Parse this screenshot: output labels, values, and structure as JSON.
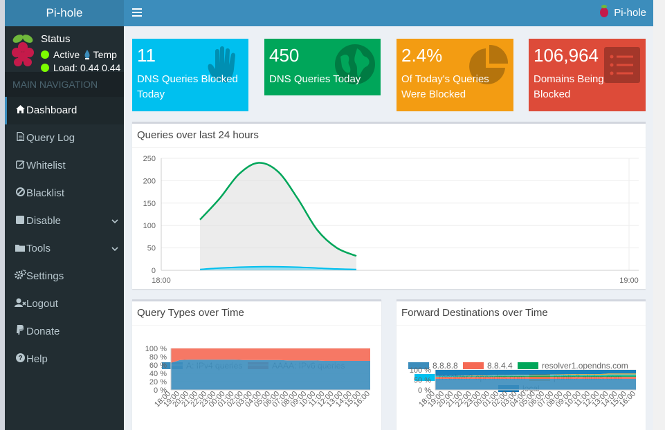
{
  "sidebar": {
    "logo": "Pi-hole",
    "status": {
      "title": "Status",
      "active": "Active",
      "temp": "Temp",
      "load_label": "Load:",
      "load_values": "0.44  0.44"
    },
    "nav_header": "MAIN NAVIGATION",
    "items": [
      {
        "label": "Dashboard",
        "icon": "home-icon"
      },
      {
        "label": "Query Log",
        "icon": "file-icon"
      },
      {
        "label": "Whitelist",
        "icon": "pencil-square-icon"
      },
      {
        "label": "Blacklist",
        "icon": "ban-icon"
      },
      {
        "label": "Disable",
        "icon": "stop-icon"
      },
      {
        "label": "Tools",
        "icon": "folder-icon"
      },
      {
        "label": "Settings",
        "icon": "gears-icon"
      },
      {
        "label": "Logout",
        "icon": "user-times-icon"
      },
      {
        "label": "Donate",
        "icon": "paypal-icon"
      },
      {
        "label": "Help",
        "icon": "question-circle-icon"
      }
    ]
  },
  "topbar": {
    "brand": "Pi-hole"
  },
  "stats": [
    {
      "value": "11",
      "label": "DNS Queries Blocked Today",
      "label_line1": "DNS Queries Blocked",
      "label_line2": "Today",
      "color": "#00c0ef",
      "icon": "hand-icon"
    },
    {
      "value": "450",
      "label": "DNS Queries Today",
      "label_line1": "DNS Queries Today",
      "label_line2": "",
      "color": "#00a65a",
      "icon": "globe-icon"
    },
    {
      "value": "2.4%",
      "label": "Of Today's Queries Were Blocked",
      "label_line1": "Of Today's Queries",
      "label_line2": "Were Blocked",
      "color": "#f39c12",
      "icon": "pie-chart-icon"
    },
    {
      "value": "106,964",
      "label": "Domains Being Blocked",
      "label_line1": "Domains Being",
      "label_line2": "Blocked",
      "color": "#dd4b39",
      "icon": "list-icon"
    }
  ],
  "chart_data": [
    {
      "type": "area",
      "title": "Queries over last 24 hours",
      "x": [
        "18:10",
        "18:15",
        "18:20",
        "18:25",
        "18:30",
        "18:35",
        "18:40",
        "18:45",
        "18:50"
      ],
      "x_tick_labels": [
        "18:00",
        "19:00"
      ],
      "ylim": [
        0,
        250
      ],
      "y_ticks": [
        0,
        50,
        100,
        150,
        200,
        250
      ],
      "series": [
        {
          "values": [
            113,
            160,
            215,
            240,
            220,
            160,
            90,
            50,
            32
          ],
          "color": "#00a65a"
        },
        {
          "values": [
            2,
            5,
            7,
            8,
            8,
            7,
            5,
            3,
            2
          ],
          "color": "#00c0ef"
        }
      ],
      "grid": true
    },
    {
      "type": "area",
      "title": "Query Types over Time",
      "x": [
        "18:00",
        "19:00",
        "20:00",
        "21:00",
        "22:00",
        "23:00",
        "00:00",
        "01:00",
        "02:00",
        "03:00",
        "04:00",
        "05:00",
        "06:00",
        "07:00",
        "08:00",
        "09:00",
        "10:00",
        "11:00",
        "12:00",
        "13:00",
        "14:00",
        "15:00",
        "16:00"
      ],
      "ylim": [
        0,
        100
      ],
      "y_ticks": [
        "0 %",
        "20 %",
        "40 %",
        "60 %",
        "80 %",
        "100 %"
      ],
      "series": [
        {
          "name": "A: IPv4 queries",
          "values": [
            65,
            72,
            73,
            73,
            73,
            73,
            73,
            73,
            72,
            72,
            72,
            72,
            72,
            71,
            71,
            71,
            71,
            70,
            70,
            70,
            70,
            70,
            70
          ],
          "color": "#3c8dbc"
        },
        {
          "name": "AAAA: IPv6 queries",
          "values": [
            35,
            28,
            27,
            27,
            27,
            27,
            27,
            27,
            28,
            28,
            28,
            28,
            28,
            29,
            29,
            29,
            29,
            30,
            30,
            30,
            30,
            30,
            30
          ],
          "color": "#f56954"
        }
      ],
      "legend": "top",
      "grid": true
    },
    {
      "type": "area",
      "title": "Forward Destinations over Time",
      "x": [
        "18:00",
        "19:00",
        "20:00",
        "21:00",
        "22:00",
        "23:00",
        "00:00",
        "01:00",
        "02:00",
        "03:00",
        "04:00",
        "05:00",
        "06:00",
        "07:00",
        "08:00",
        "09:00",
        "10:00",
        "11:00",
        "12:00",
        "13:00",
        "14:00",
        "15:00",
        "16:00"
      ],
      "ylim": [
        0,
        100
      ],
      "y_ticks": [
        "0 %",
        "50 %",
        "100 %"
      ],
      "series": [
        {
          "name": "8.8.8.8",
          "values": [
            55,
            55,
            55,
            55,
            55,
            55,
            55,
            55,
            55,
            55,
            55,
            55,
            55,
            55,
            55,
            55,
            55,
            55,
            55,
            55,
            55,
            55,
            55
          ],
          "color": "#3c8dbc"
        },
        {
          "name": "8.8.4.4",
          "values": [
            10,
            10,
            10,
            10,
            10,
            10,
            10,
            10,
            10,
            10,
            10,
            10,
            10,
            10,
            10,
            10,
            10,
            10,
            10,
            10,
            10,
            10,
            10
          ],
          "color": "#f56954"
        },
        {
          "name": "resolver1.opendns.com",
          "values": [
            2,
            2,
            2,
            3,
            3,
            3,
            3,
            4,
            4,
            4,
            4,
            5,
            5,
            5,
            5,
            6,
            6,
            6,
            6,
            7,
            7,
            7,
            7
          ],
          "color": "#00a65a"
        },
        {
          "name": "resolver2.opendns.com",
          "values": [
            2,
            2,
            2,
            2,
            2,
            2,
            3,
            3,
            3,
            3,
            3,
            3,
            3,
            4,
            4,
            4,
            4,
            4,
            4,
            5,
            5,
            5,
            5
          ],
          "color": "#00c0ef"
        },
        {
          "name": "public2.alidns.com",
          "values": [
            1,
            1,
            1,
            1,
            2,
            2,
            2,
            2,
            2,
            3,
            3,
            3,
            3,
            3,
            4,
            4,
            4,
            4,
            4,
            5,
            5,
            5,
            5
          ],
          "color": "#f39c12"
        },
        {
          "name": "local",
          "values": [
            30,
            30,
            30,
            29,
            28,
            28,
            27,
            26,
            26,
            25,
            25,
            24,
            24,
            23,
            22,
            21,
            21,
            21,
            21,
            18,
            18,
            18,
            18
          ],
          "color": "#0073b7"
        }
      ],
      "legend": "top",
      "grid": true
    }
  ]
}
